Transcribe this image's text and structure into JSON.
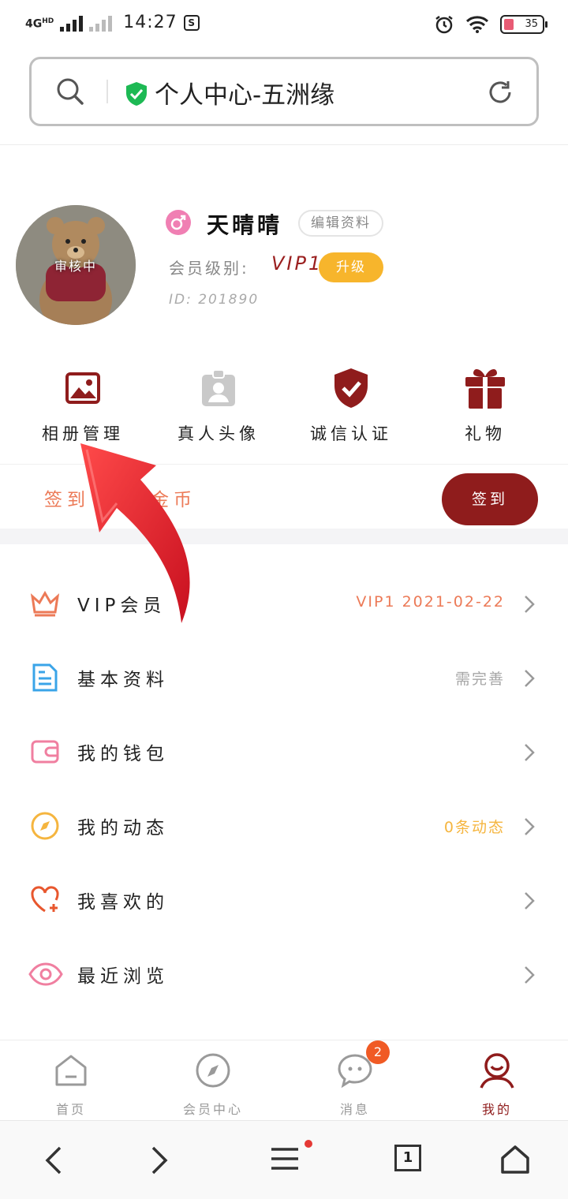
{
  "status_bar": {
    "network": "4G",
    "network_sup": "HD",
    "time": "14:27",
    "app_glyph": "S",
    "battery": "35"
  },
  "address_bar": {
    "title": "个人中心-五洲缘",
    "search_icon": "search-icon",
    "security_icon": "shield-check-icon",
    "reload_icon": "reload-icon"
  },
  "profile": {
    "avatar_badge": "审核中",
    "nickname": "天晴晴",
    "edit_label": "编辑资料",
    "level_label": "会员级别:",
    "level_value": "VIP1",
    "upgrade_label": "升级",
    "user_id": "ID: 201890"
  },
  "actions": [
    {
      "label": "相册管理",
      "icon": "photo-album-icon"
    },
    {
      "label": "真人头像",
      "icon": "id-badge-icon"
    },
    {
      "label": "诚信认证",
      "icon": "shield-check-icon"
    },
    {
      "label": "礼物",
      "icon": "gift-icon"
    }
  ],
  "signin": {
    "text": "签到",
    "text_tail": "领金币",
    "button": "签到"
  },
  "menu": [
    {
      "label": "VIP会员",
      "value": "VIP1 2021-02-22",
      "value_color": "#ec7a57",
      "icon": "crown-icon"
    },
    {
      "label": "基本资料",
      "value": "需完善",
      "value_color": "#a6a6a6",
      "icon": "document-icon"
    },
    {
      "label": "我的钱包",
      "value": "",
      "value_color": "#a6a6a6",
      "icon": "wallet-icon"
    },
    {
      "label": "我的动态",
      "value": "0条动态",
      "value_color": "#f5b53f",
      "icon": "compass-icon"
    },
    {
      "label": "我喜欢的",
      "value": "",
      "value_color": "#a6a6a6",
      "icon": "heart-plus-icon"
    },
    {
      "label": "最近浏览",
      "value": "",
      "value_color": "#a6a6a6",
      "icon": "eye-icon"
    }
  ],
  "tabbar": [
    {
      "label": "首页",
      "icon": "home-icon"
    },
    {
      "label": "会员中心",
      "icon": "compass-icon"
    },
    {
      "label": "消息",
      "icon": "chat-icon",
      "badge": "2"
    },
    {
      "label": "我的",
      "icon": "user-icon",
      "active": true
    }
  ],
  "browser_nav": {
    "tabs_count": "1"
  },
  "colors": {
    "brand": "#8f1c1c",
    "accent_orange": "#ec7a57",
    "upgrade": "#f7b52c",
    "arrow": "#e8202f"
  }
}
